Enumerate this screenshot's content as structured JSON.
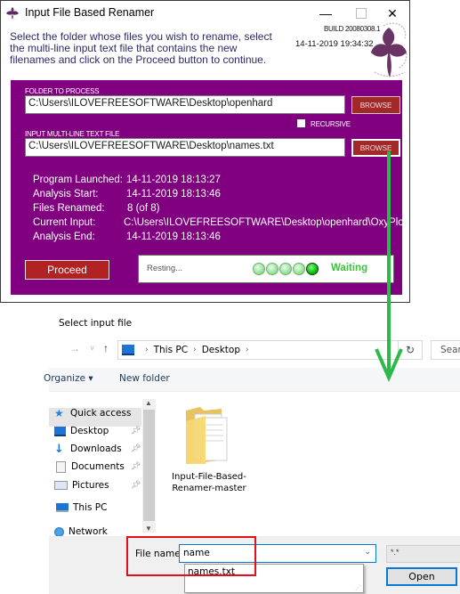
{
  "app": {
    "title": "Input File Based Renamer",
    "window_controls": {
      "minimize": "—",
      "close": "✕"
    },
    "description": "Select the folder whose files you wish to rename, select the multi-line input text file that contains the new filenames and click on the Proceed button to continue.",
    "build": "BUILD 20080308.1",
    "current_datetime": "14-11-2019 19:34:32",
    "folder_section": {
      "label": "FOLDER TO PROCESS",
      "value": "C:\\Users\\ILOVEFREESOFTWARE\\Desktop\\openhard",
      "browse_label": "BROWSE"
    },
    "recursive": {
      "label": "RECURSIVE",
      "checked": false
    },
    "input_section": {
      "label": "INPUT MULTI-LINE TEXT FILE",
      "value": "C:\\Users\\ILOVEFREESOFTWARE\\Desktop\\names.txt",
      "browse_label": "BROWSE"
    },
    "stats": [
      {
        "key": "Program Launched:",
        "value": "14-11-2019 18:13:27"
      },
      {
        "key": "Analysis Start:",
        "value": "14-11-2019 18:13:46"
      },
      {
        "key": "Files Renamed:",
        "value": "8 (of 8)"
      },
      {
        "key": "Current Input:",
        "value": "C:\\Users\\ILOVEFREESOFTWARE\\Desktop\\openhard\\OxyPlot"
      },
      {
        "key": "Analysis End:",
        "value": "14-11-2019 18:13:46"
      }
    ],
    "proceed_label": "Proceed",
    "status": {
      "text": "Resting...",
      "indicator_count": 5,
      "active_indicator": 5,
      "state_label": "Waiting"
    },
    "colors": {
      "panel": "#800080",
      "button": "#a32828",
      "status_green": "#3ac43a",
      "arrow": "#2db84a",
      "highlight": "#e3101c"
    }
  },
  "dialog": {
    "title": "Select input file",
    "nav": {
      "forward": "→",
      "recent": "˅",
      "up": "↑"
    },
    "breadcrumb": [
      "This PC",
      "Desktop"
    ],
    "search_placeholder": "Search Desktop",
    "toolbar": {
      "organize": "Organize ▾",
      "new_folder": "New folder"
    },
    "sidebar": [
      {
        "label": "Quick access",
        "icon": "star-icon",
        "pinned": false
      },
      {
        "label": "Desktop",
        "icon": "desktop-icon",
        "pinned": true
      },
      {
        "label": "Downloads",
        "icon": "download-icon",
        "pinned": true
      },
      {
        "label": "Documents",
        "icon": "documents-icon",
        "pinned": true
      },
      {
        "label": "Pictures",
        "icon": "pictures-icon",
        "pinned": true
      },
      {
        "label": "This PC",
        "icon": "computer-icon",
        "pinned": false,
        "selected": true
      },
      {
        "label": "Network",
        "icon": "network-icon",
        "pinned": false
      }
    ],
    "files": [
      {
        "name": "Input-File-Based-Renamer-master",
        "type": "folder"
      }
    ],
    "file_name_label": "File name:",
    "file_name_value": "name",
    "autocomplete": [
      "names.txt"
    ],
    "filter_value": "*.*",
    "open_label": "Open"
  }
}
